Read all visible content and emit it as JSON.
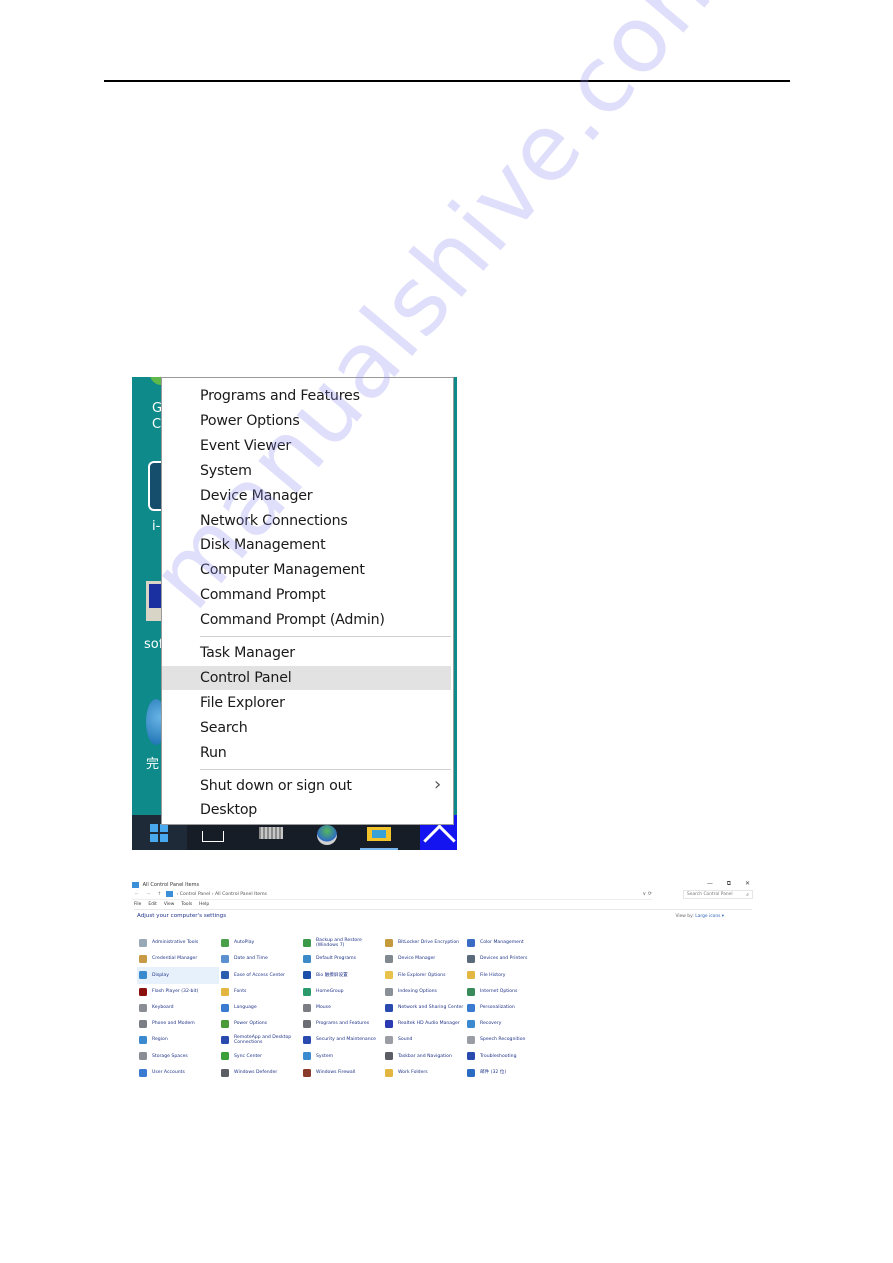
{
  "page": {
    "watermark": "manualshive.com"
  },
  "winx_menu": {
    "groups": [
      [
        "Programs and Features",
        "Power Options",
        "Event Viewer",
        "System",
        "Device Manager",
        "Network Connections",
        "Disk Management",
        "Computer Management",
        "Command Prompt",
        "Command Prompt (Admin)"
      ],
      [
        "Task Manager",
        "Control Panel",
        "File Explorer",
        "Search",
        "Run"
      ],
      [
        "Shut down or sign out",
        "Desktop"
      ]
    ],
    "highlighted": "Control Panel",
    "submenu_chevron": "›"
  },
  "desktop": {
    "icon_labels_partial": [
      "G",
      "C",
      "i-",
      "sof",
      "完"
    ]
  },
  "control_panel": {
    "window_title": "All Control Panel Items",
    "window_buttons": {
      "minimize": "—",
      "maximize": "⧉",
      "close": "✕"
    },
    "address": {
      "back": "←",
      "forward": "→",
      "up": "↑",
      "path": [
        "Control Panel",
        "All Control Panel Items"
      ],
      "separator": "›",
      "dropdown": "∨",
      "refresh": "⟳"
    },
    "search_placeholder": "Search Control Panel",
    "search_icon": "⌕",
    "menubar": [
      "File",
      "Edit",
      "View",
      "Tools",
      "Help"
    ],
    "heading": "Adjust your computer's settings",
    "view_by_label": "View by:",
    "view_by_value": "Large icons ▾",
    "selected_item": "Display",
    "items": [
      {
        "label": "Administrative Tools",
        "icon": "admin-tools-icon",
        "color": "#9aa7b5"
      },
      {
        "label": "AutoPlay",
        "icon": "autoplay-icon",
        "color": "#4aa04a"
      },
      {
        "label": "Backup and Restore (Windows 7)",
        "icon": "backup-icon",
        "color": "#3c9b4a"
      },
      {
        "label": "BitLocker Drive Encryption",
        "icon": "bitlocker-icon",
        "color": "#c49a3c"
      },
      {
        "label": "Color Management",
        "icon": "color-management-icon",
        "color": "#3a6cc4"
      },
      {
        "label": "Credential Manager",
        "icon": "credential-manager-icon",
        "color": "#c99a46"
      },
      {
        "label": "Date and Time",
        "icon": "date-time-icon",
        "color": "#5a8fd0"
      },
      {
        "label": "Default Programs",
        "icon": "default-programs-icon",
        "color": "#3c8ac8"
      },
      {
        "label": "Device Manager",
        "icon": "device-manager-icon",
        "color": "#808890"
      },
      {
        "label": "Devices and Printers",
        "icon": "devices-printers-icon",
        "color": "#5a6a7a"
      },
      {
        "label": "Display",
        "icon": "display-icon",
        "color": "#3a8ad0"
      },
      {
        "label": "Ease of Access Center",
        "icon": "ease-of-access-icon",
        "color": "#2a5fb0"
      },
      {
        "label": "Bio 触摸屏设置",
        "icon": "bio-icon",
        "color": "#1a4ea8"
      },
      {
        "label": "File Explorer Options",
        "icon": "file-explorer-options-icon",
        "color": "#e8c24a"
      },
      {
        "label": "File History",
        "icon": "file-history-icon",
        "color": "#e2b640"
      },
      {
        "label": "Flash Player (32-bit)",
        "icon": "flash-player-icon",
        "color": "#8a1010"
      },
      {
        "label": "Fonts",
        "icon": "fonts-icon",
        "color": "#e2b640"
      },
      {
        "label": "HomeGroup",
        "icon": "homegroup-icon",
        "color": "#2a9a6a"
      },
      {
        "label": "Indexing Options",
        "icon": "indexing-options-icon",
        "color": "#8a9098"
      },
      {
        "label": "Internet Options",
        "icon": "internet-options-icon",
        "color": "#3a8a5a"
      },
      {
        "label": "Keyboard",
        "icon": "keyboard-icon",
        "color": "#8a8e94"
      },
      {
        "label": "Language",
        "icon": "language-icon",
        "color": "#3a7ad0"
      },
      {
        "label": "Mouse",
        "icon": "mouse-icon",
        "color": "#7a7e84"
      },
      {
        "label": "Network and Sharing Center",
        "icon": "network-sharing-icon",
        "color": "#2a4ab0"
      },
      {
        "label": "Personalization",
        "icon": "personalization-icon",
        "color": "#3a7ad0"
      },
      {
        "label": "Phone and Modem",
        "icon": "phone-modem-icon",
        "color": "#7a7e84"
      },
      {
        "label": "Power Options",
        "icon": "power-options-icon",
        "color": "#4a9a3a"
      },
      {
        "label": "Programs and Features",
        "icon": "programs-features-icon",
        "color": "#6a6e74"
      },
      {
        "label": "Realtek HD Audio Manager",
        "icon": "realtek-audio-icon",
        "color": "#2a3ab0"
      },
      {
        "label": "Recovery",
        "icon": "recovery-icon",
        "color": "#3a8ad0"
      },
      {
        "label": "Region",
        "icon": "region-icon",
        "color": "#3a8ad0"
      },
      {
        "label": "RemoteApp and Desktop Connections",
        "icon": "remoteapp-icon",
        "color": "#2a4ab0"
      },
      {
        "label": "Security and Maintenance",
        "icon": "security-maintenance-icon",
        "color": "#2a4ab0"
      },
      {
        "label": "Sound",
        "icon": "sound-icon",
        "color": "#9a9ea4"
      },
      {
        "label": "Speech Recognition",
        "icon": "speech-recognition-icon",
        "color": "#9a9ea4"
      },
      {
        "label": "Storage Spaces",
        "icon": "storage-spaces-icon",
        "color": "#8a8e94"
      },
      {
        "label": "Sync Center",
        "icon": "sync-center-icon",
        "color": "#3aa03a"
      },
      {
        "label": "System",
        "icon": "system-icon",
        "color": "#3a8ad0"
      },
      {
        "label": "Taskbar and Navigation",
        "icon": "taskbar-navigation-icon",
        "color": "#5a5e64"
      },
      {
        "label": "Troubleshooting",
        "icon": "troubleshooting-icon",
        "color": "#2a4ab0"
      },
      {
        "label": "User Accounts",
        "icon": "user-accounts-icon",
        "color": "#3a7ad0"
      },
      {
        "label": "Windows Defender",
        "icon": "windows-defender-icon",
        "color": "#5a5e64"
      },
      {
        "label": "Windows Firewall",
        "icon": "windows-firewall-icon",
        "color": "#8a3a2a"
      },
      {
        "label": "Work Folders",
        "icon": "work-folders-icon",
        "color": "#e2b640"
      },
      {
        "label": "邮件 (32 位)",
        "icon": "mail-icon",
        "color": "#2a6ac0"
      }
    ]
  }
}
